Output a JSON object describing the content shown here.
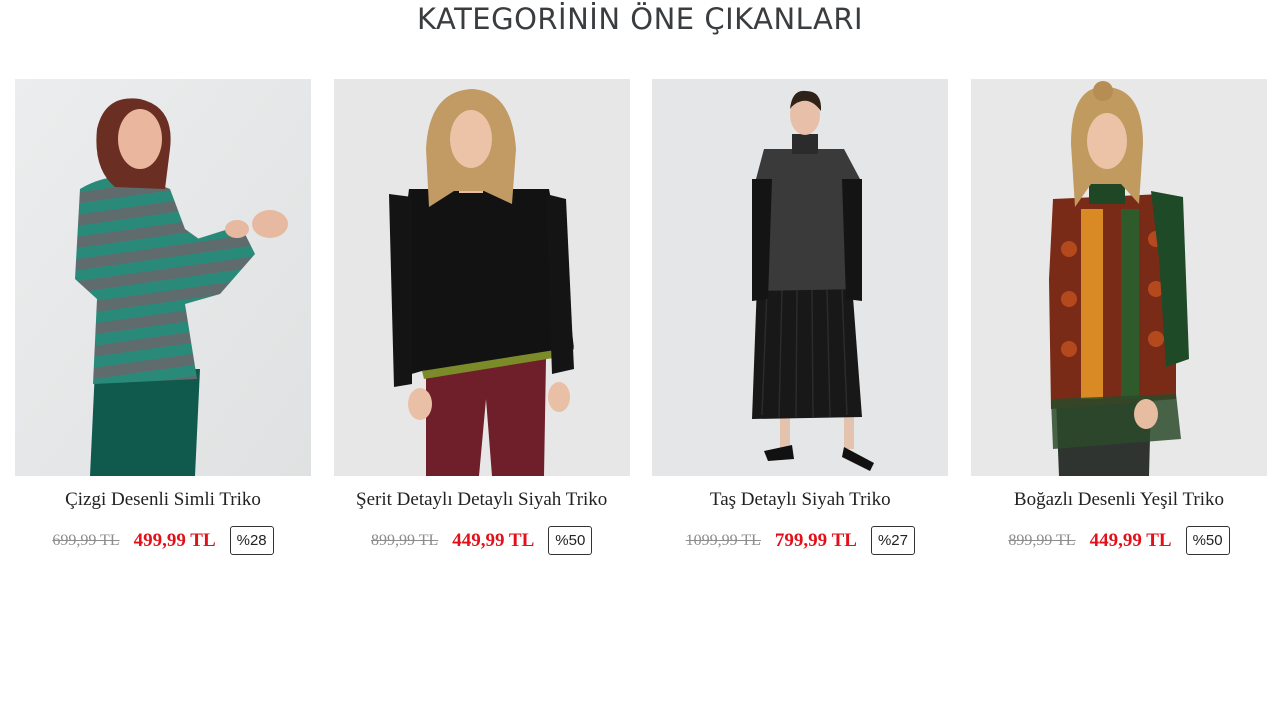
{
  "section": {
    "title": "KATEGORİNİN ÖNE ÇIKANLARI"
  },
  "products": [
    {
      "name": "Çizgi Desenli Simli Triko",
      "old_price": "699,99 TL",
      "new_price": "499,99 TL",
      "discount": "%28",
      "image": "model-green-striped-sweater"
    },
    {
      "name": "Şerit Detaylı Detaylı Siyah Triko",
      "old_price": "899,99 TL",
      "new_price": "449,99 TL",
      "discount": "%50",
      "image": "model-black-sweater-green-hem"
    },
    {
      "name": "Taş Detaylı Siyah Triko",
      "old_price": "1099,99 TL",
      "new_price": "799,99 TL",
      "discount": "%27",
      "image": "model-black-sweater-skirt"
    },
    {
      "name": "Boğazlı Desenli Yeşil Triko",
      "old_price": "899,99 TL",
      "new_price": "449,99 TL",
      "discount": "%50",
      "image": "model-green-patterned-turtleneck"
    }
  ],
  "colors": {
    "sale_price": "#e3101a",
    "old_price": "#8d8d8d",
    "title": "#3a3d40",
    "photo_background": "#e8e9ea"
  }
}
